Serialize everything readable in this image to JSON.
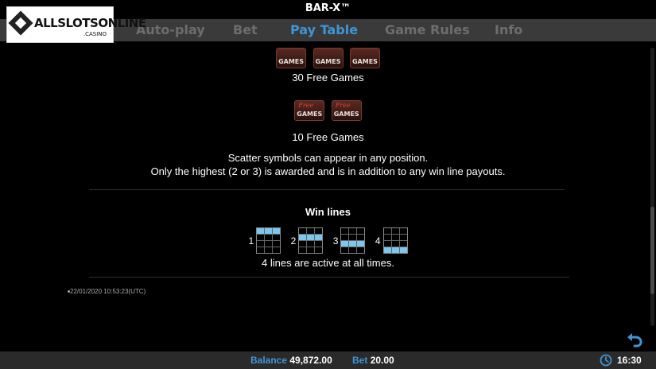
{
  "title": "BAR-X™",
  "logo": {
    "text": "ALLSLOTSONLINE",
    "sub": ".CASINO"
  },
  "tabs": [
    {
      "label": "Auto-play",
      "active": false
    },
    {
      "label": "Bet",
      "active": false
    },
    {
      "label": "Pay Table",
      "active": true
    },
    {
      "label": "Game Rules",
      "active": false
    },
    {
      "label": "Info",
      "active": false
    }
  ],
  "scatter": {
    "symbol_label": "GAMES",
    "symbol_script": "Free",
    "row3_caption": "30 Free Games",
    "row2_caption": "10 Free Games",
    "note_line1": "Scatter symbols can appear in any position.",
    "note_line2": "Only the highest (2 or 3) is awarded and is in addition to any win line payouts."
  },
  "win_lines": {
    "title": "Win lines",
    "lines": [
      {
        "number": "1",
        "row": 0
      },
      {
        "number": "2",
        "row": 1
      },
      {
        "number": "3",
        "row": 2
      },
      {
        "number": "4",
        "row": 3
      }
    ],
    "note": "4 lines are active at all times."
  },
  "timestamp": "22/01/2020 10:53:23(UTC)",
  "footer": {
    "balance_label": "Balance",
    "balance_value": "49,872.00",
    "bet_label": "Bet",
    "bet_value": "20.00",
    "time": "16:30"
  },
  "colors": {
    "accent": "#3f95d7",
    "tab_inactive": "#6d6d6d",
    "line_cell": "#7cc7f0"
  },
  "icons": {
    "back": "undo-arrow-icon",
    "clock": "clock-icon"
  }
}
